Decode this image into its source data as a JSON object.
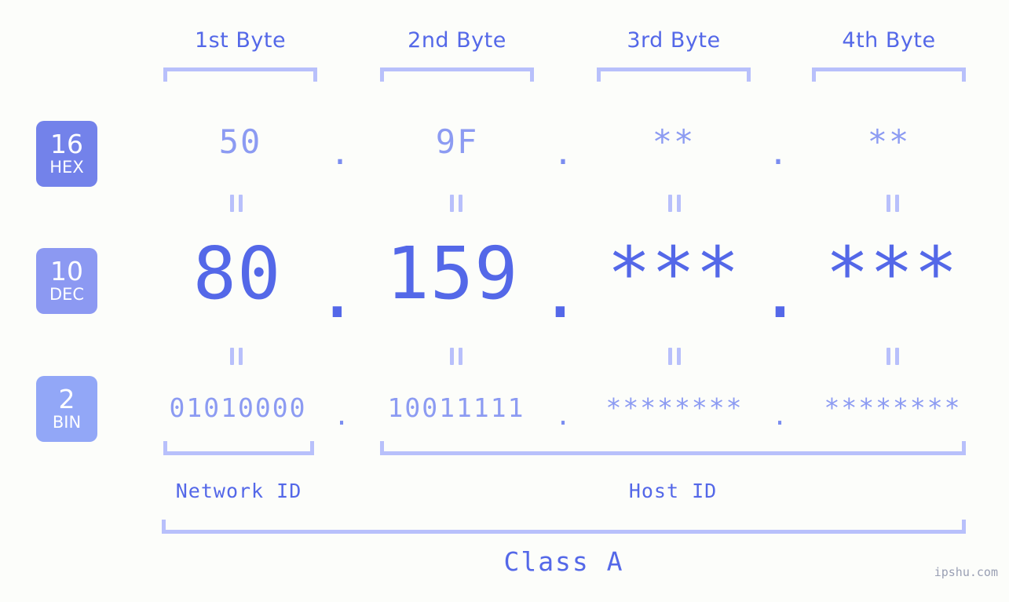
{
  "watermark": "ipshu.com",
  "byte_headers": [
    {
      "label": "1st Byte"
    },
    {
      "label": "2nd Byte"
    },
    {
      "label": "3rd Byte"
    },
    {
      "label": "4th Byte"
    }
  ],
  "bases": [
    {
      "number": "16",
      "name": "HEX",
      "color": "#7382ea"
    },
    {
      "number": "10",
      "name": "DEC",
      "color": "#8c99f2"
    },
    {
      "number": "2",
      "name": "BIN",
      "color": "#92a7f7"
    }
  ],
  "rows": {
    "hex": {
      "base_number": "16",
      "base_name": "HEX",
      "values": [
        "50",
        "9F",
        "**",
        "**"
      ],
      "separators": [
        ".",
        ".",
        "."
      ]
    },
    "dec": {
      "base_number": "10",
      "base_name": "DEC",
      "values": [
        "80",
        "159",
        "***",
        "***"
      ],
      "separators": [
        ".",
        ".",
        "."
      ]
    },
    "bin": {
      "base_number": "2",
      "base_name": "BIN",
      "values": [
        "01010000",
        "10011111",
        "********",
        "********"
      ],
      "separators": [
        ".",
        ".",
        "."
      ]
    }
  },
  "equals_markers": {
    "symbol": "=",
    "count_per_gap": 4,
    "gaps": 2
  },
  "groupings": {
    "network_id": "Network ID",
    "host_id": "Host ID",
    "class": "Class A"
  },
  "colors": {
    "background": "#fcfdfa",
    "accent_strong": "#5468e8",
    "accent_mid": "#8c9bf2",
    "accent_light": "#b8c0fb",
    "badge_hex": "#7382ea",
    "badge_dec": "#8c99f2",
    "badge_bin": "#92a7f7"
  }
}
